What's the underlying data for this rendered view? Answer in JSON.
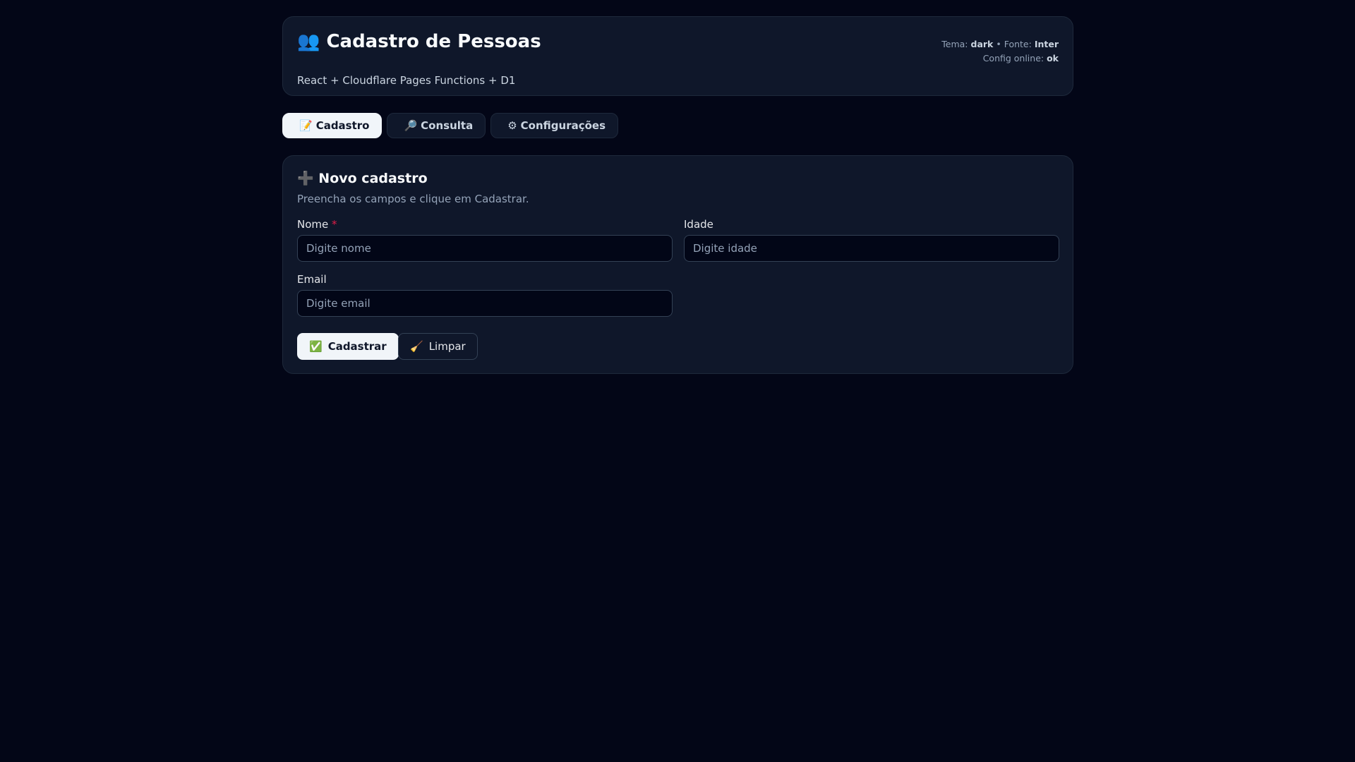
{
  "header": {
    "icon": "👥",
    "title": "Cadastro de Pessoas",
    "subtitle": "React + Cloudflare Pages Functions + D1",
    "theme_label": "Tema:",
    "theme_value": "dark",
    "sep": "•",
    "font_label": "Fonte:",
    "font_value": "Inter",
    "config_label": "Config online:",
    "config_value": "ok"
  },
  "tabs": [
    {
      "icon": "📝",
      "label": "Cadastro"
    },
    {
      "icon": "🔎",
      "label": "Consulta"
    },
    {
      "icon": "⚙",
      "label": "Configurações"
    }
  ],
  "form": {
    "icon": "➕",
    "title": "Novo cadastro",
    "subtitle": "Preencha os campos e clique em Cadastrar.",
    "fields": [
      {
        "label": "Nome",
        "required": "*",
        "placeholder": "Digite nome"
      },
      {
        "label": "Idade",
        "placeholder": "Digite idade"
      },
      {
        "label": "Email",
        "placeholder": "Digite email"
      }
    ],
    "submit": {
      "icon": "✅",
      "label": "Cadastrar"
    },
    "clear": {
      "icon": "🧹",
      "label": "Limpar"
    }
  }
}
